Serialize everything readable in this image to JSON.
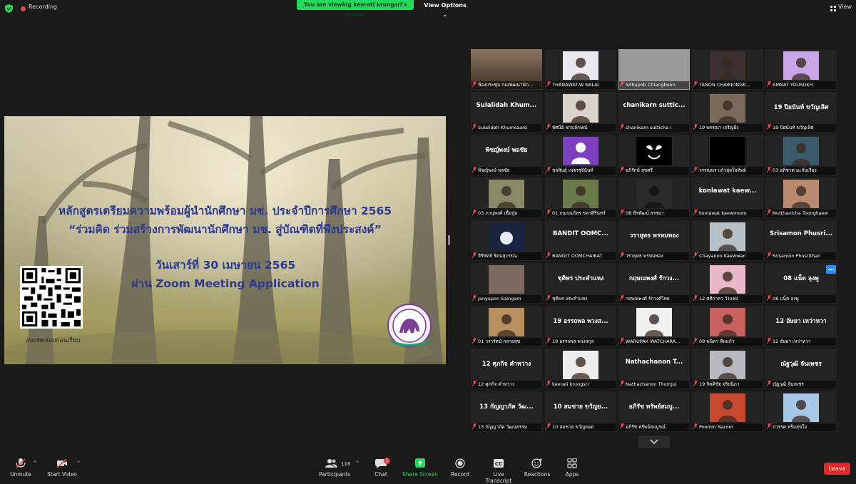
{
  "topbar": {
    "recording_label": "Recording",
    "viewing_banner": "You are viewing keerati krungsri's screen",
    "view_options": "View Options",
    "view_label": "View"
  },
  "slide": {
    "line1": "หลักสูตรเตรียมความพร้อมผู้นำนักศึกษา มช. ประจำปีการศึกษา 2565",
    "line2": "“ร่วมคิด ร่วมสร้างการพัฒนานักศึกษา มช. สู่บัณฑิตที่พึงประสงค์”",
    "line3": "วันเสาร์ที่ 30 เมษายน 2565",
    "line4": "ผ่าน Zoom Meeting Application",
    "qr_label": "แบบทดสอบก่อนเรียน"
  },
  "gallery": {
    "tiles": [
      {
        "caption": "ห้องประชุม กองพัฒนานัก...",
        "big": "",
        "video": "room"
      },
      {
        "caption": "THANAWAT-W NALAI",
        "big": "",
        "video": "person-white"
      },
      {
        "caption": "Sithapob Chiangboon",
        "big": "",
        "video": "gray"
      },
      {
        "caption": "TANON CHAIMONGK...",
        "big": "",
        "video": "person-dark"
      },
      {
        "caption": "AMNAT YOUSUKH",
        "big": "",
        "video": "person-purple"
      },
      {
        "caption": "Sulalidah Khumsaard",
        "big": "Sulalidah  Khum...",
        "video": ""
      },
      {
        "caption": "ทัศนีย์ ชามลักษณ์",
        "big": "",
        "video": "person-light"
      },
      {
        "caption": "chanikarn sutticha i",
        "big": "chanikarn  suttic...",
        "video": ""
      },
      {
        "caption": "19 พรรณา เจริญยิ่ง",
        "big": "",
        "video": "person-room"
      },
      {
        "caption": "19 ปิยนันท์ ขวัญเลิศ",
        "big": "19 ปิยนันท์ ขวัญเลิศ",
        "video": ""
      },
      {
        "caption": "พิชญ์พงษ์ พลชัย",
        "big": "พิชญ์พงษ์ พลชัย",
        "video": ""
      },
      {
        "caption": "ชลสินธุ์ เพชรรุจินันท์",
        "big": "",
        "video": "avatar"
      },
      {
        "caption": "อภิรักษ์ สุขศรี",
        "big": "",
        "video": "venom"
      },
      {
        "caption": "วรรณพร แก้วสุดใจทิพย์",
        "big": "",
        "video": "black"
      },
      {
        "caption": "03 อภิชาต มะจันเรือง",
        "big": "",
        "video": "group-blue"
      },
      {
        "caption": "03 ภานุพงศ์ เชื่อปุ่ม",
        "big": "",
        "video": "person-outdoor"
      },
      {
        "caption": "01 กนกณภัทร ชลาศิรินทร์",
        "big": "",
        "video": "person-outdoor2"
      },
      {
        "caption": "08 พีรพัฒน์ ธรรมา",
        "big": "",
        "video": "silhouette"
      },
      {
        "caption": "konlawat kaewmoon",
        "big": "konlawat  kaew...",
        "video": ""
      },
      {
        "caption": "Nutthanicha Toongkaew",
        "big": "",
        "video": "person-warm"
      },
      {
        "caption": "สิริพัทธ์ รัตนสุวรรณ",
        "big": "",
        "video": "moon"
      },
      {
        "caption": "BANDIT OOMCHAIKAT",
        "big": "BANDIT  OOMC...",
        "video": ""
      },
      {
        "caption": "วรายุทธ พรหมทอง",
        "big": "วรายุทธ พรหมทอง",
        "video": ""
      },
      {
        "caption": "Chayanon Kaewwan",
        "big": "",
        "video": "person-cool"
      },
      {
        "caption": "Srisamon Phusrithan",
        "big": "Srisamon  Phusri...",
        "video": ""
      },
      {
        "caption": "Janyapon Saingam",
        "big": "",
        "video": "blur"
      },
      {
        "caption": "ชุติพร ประคำแหง",
        "big": "ชุติพร ประคำแหง",
        "video": ""
      },
      {
        "caption": "กฤษณพงศ์ รักวงศ์ไทย",
        "big": "กฤษณพงศ์ รักวง...",
        "video": ""
      },
      {
        "caption": "12 ศศิกาลา วังแฟง",
        "big": "",
        "video": "cartoon"
      },
      {
        "caption": "08 แน็ต ลุงพู",
        "big": "08 แน็ต ลุงพู",
        "video": ""
      },
      {
        "caption": "01 วรารัตน์ กลายสุข",
        "big": "",
        "video": "hedgehog"
      },
      {
        "caption": "19 อรรถพล พวงสกุล",
        "big": "19 อรรถพล พวงส...",
        "video": ""
      },
      {
        "caption": "WARUPAK WATCHARA...",
        "big": "",
        "video": "person-black"
      },
      {
        "caption": "08 พนิดา ทีพแก้ว",
        "big": "",
        "video": "person-red"
      },
      {
        "caption": "12 อัษยา เหว่าหวา",
        "big": "12 อัษยา เหว่าหวา",
        "video": ""
      },
      {
        "caption": "12 ศุภกิจ คำหว่าง",
        "big": "12 ศุภกิจ คำหว่าง",
        "video": ""
      },
      {
        "caption": "keerati krungsri",
        "big": "",
        "video": "person-glasses"
      },
      {
        "caption": "Nathachanon Thumjui",
        "big": "Nathachanon  T...",
        "video": ""
      },
      {
        "caption": "19 กิตติชัย จริยนิภา",
        "big": "",
        "video": "building"
      },
      {
        "caption": "ณัฐวุฒิ จันเพชร",
        "big": "ณัฐวุฒิ จันเพชร",
        "video": ""
      },
      {
        "caption": "13 กัญญาภัค วัฒนธรรม",
        "big": "13 กัญญาภัค วัฒ...",
        "video": ""
      },
      {
        "caption": "10 สมชาย ขวัญยอด",
        "big": "10 สมชาย ขวัญย...",
        "video": ""
      },
      {
        "caption": "อภิรัช ทรัพย์สมบูรณ์",
        "big": "อภิรัช ทรัพย์สมบู...",
        "video": ""
      },
      {
        "caption": "Poomin Narom",
        "big": "",
        "video": "anime-red"
      },
      {
        "caption": "ปวรรศ หริ่มสุขใจ",
        "big": "",
        "video": "anime-blue"
      }
    ]
  },
  "toolbar": {
    "unmute": "Unmute",
    "start_video": "Start Video",
    "participants": "Participants",
    "participants_count": "116",
    "chat": "Chat",
    "chat_badge": "1",
    "share_screen": "Share Screen",
    "record": "Record",
    "live_transcript": "Live Transcript",
    "reactions": "Reactions",
    "apps": "Apps",
    "leave": "Leave"
  },
  "colors": {
    "share_green": "#23d959",
    "leave_red": "#e02828",
    "mic_muted_red": "#e64a4a",
    "accent_blue": "#2d8cff",
    "slide_title": "#2b3a8c"
  }
}
